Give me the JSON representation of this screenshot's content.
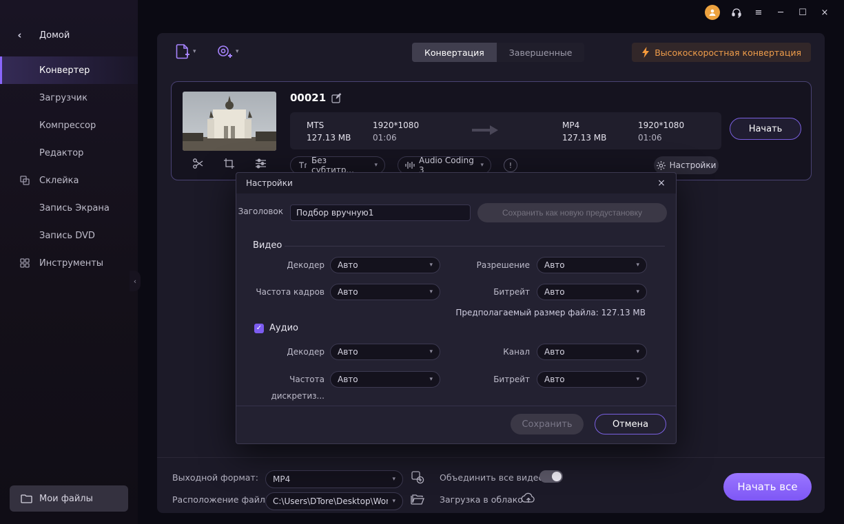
{
  "icons": {
    "caret": "▾",
    "close": "×",
    "minimize": "─",
    "maximize": "☐",
    "menu": "≡",
    "back": "‹",
    "check": "✓",
    "info": "!"
  },
  "sidebar": {
    "home": "Домой",
    "items": [
      {
        "label": "Конвертер"
      },
      {
        "label": "Загрузчик"
      },
      {
        "label": "Компрессор"
      },
      {
        "label": "Редактор"
      },
      {
        "label": "Склейка"
      },
      {
        "label": "Запись Экрана"
      },
      {
        "label": "Запись DVD"
      },
      {
        "label": "Инструменты"
      }
    ],
    "my_files": "Мои файлы"
  },
  "toolbar": {
    "tabs": [
      {
        "label": "Конвертация"
      },
      {
        "label": "Завершенные"
      }
    ],
    "badge": "Высокоскоростная конвертация"
  },
  "file_card": {
    "title": "00021",
    "source": {
      "format": "MTS",
      "size": "127.13 MB",
      "resolution": "1920*1080",
      "duration": "01:06"
    },
    "target": {
      "format": "MP4",
      "size": "127.13 MB",
      "resolution": "1920*1080",
      "duration": "01:06"
    },
    "start_button": "Начать",
    "subtitle_dropdown": "Без субтитр...",
    "audio_dropdown": "Audio Coding 3",
    "settings_button": "Настройки"
  },
  "settings_dialog": {
    "title": "Настройки",
    "field_title_label": "Заголовок",
    "field_title_value": "Подбор вручную1",
    "save_preset_button": "Сохранить как новую предустановку",
    "video_label": "Видео",
    "video_fields": [
      {
        "label": "Декодер",
        "value": "Авто"
      },
      {
        "label": "Разрешение",
        "value": "Авто"
      },
      {
        "label": "Частота кадров",
        "value": "Авто"
      },
      {
        "label": "Битрейт",
        "value": "Авто"
      }
    ],
    "estimated_size": "Предполагаемый размер файла: 127.13 MB",
    "audio_label": "Аудио",
    "audio_fields": [
      {
        "label": "Декодер",
        "value": "Авто"
      },
      {
        "label": "Канал",
        "value": "Авто"
      },
      {
        "label": "Частота дискретиз...",
        "value": "Авто"
      },
      {
        "label": "Битрейт",
        "value": "Авто"
      }
    ],
    "save_button": "Сохранить",
    "cancel_button": "Отмена"
  },
  "footer": {
    "output_format_label": "Выходной формат:",
    "output_format_value": "MP4",
    "merge_label": "Объединить все видео",
    "location_label": "Расположение файла:",
    "location_value": "C:\\Users\\DTore\\Desktop\\Won",
    "cloud_label": "Загрузка в облако",
    "start_all_button": "Начать все"
  }
}
